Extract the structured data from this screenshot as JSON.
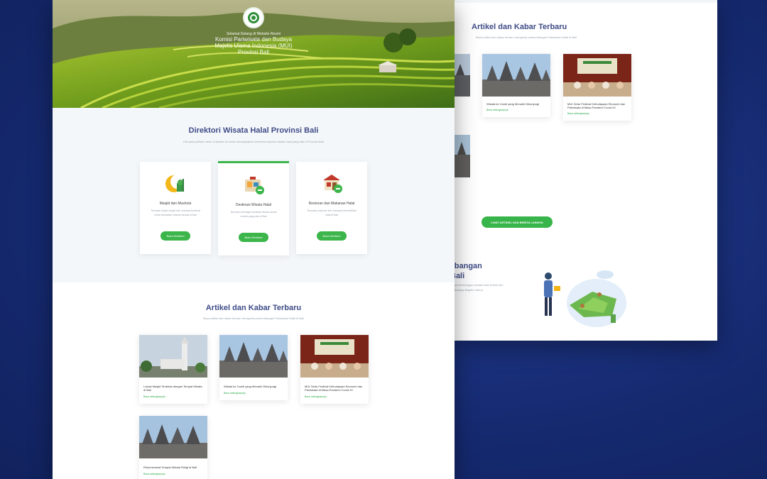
{
  "hero": {
    "line1": "Selamat Datang di Website Resmi",
    "line2": "Komisi Pariwisata dan Budaya",
    "line3": "Majelis Ulama Indonesia (MUI)",
    "line4": "Provinsi Bali"
  },
  "directory": {
    "title": "Direktori Wisata Halal Provinsi Bali",
    "subtitle": "Klik pada pilihan menu di bawah ini untuk mendapatkan informasi seputar wisata halal yang ada di Provinsi Bali",
    "cards": [
      {
        "title": "Masjid dan Mushola",
        "desc": "Temukan lokasi masjid dan mushola terdekat untuk beribadah selama berada di Bali",
        "button": "Buka Direktori"
      },
      {
        "title": "Destinasi Wisata Halal",
        "desc": "Temukan berbagai destinasi wisata ramah muslim yang ada di Bali",
        "button": "Buka Direktori"
      },
      {
        "title": "Restoran dan Makanan Halal",
        "desc": "Temukan restoran dan makanan bersertifikat halal di Bali",
        "button": "Buka Direktori"
      }
    ]
  },
  "articles": {
    "title": "Artikel dan Kabar Terbaru",
    "subtitle": "Baca artikel dan kabar terbaru mengenai perkembangan Pariwisata Halal di Bali",
    "items": [
      {
        "title": "Lokasi Masjid Terdekat dengan Tempat Wisata di Bali",
        "meta": "Baca selengkapnya"
      },
      {
        "title": "Wisata ke Candi yang Menarik Dikunjungi",
        "meta": "Baca selengkapnya"
      },
      {
        "title": "MUI Gelar Festival Kebudayaan Ekonomi dan Pariwisata di Masa Pandemi Covid-19",
        "meta": "Baca selengkapnya"
      },
      {
        "title": "Rekomendasi Tempat Wisata Religi di Bali",
        "meta": "Baca selengkapnya"
      }
    ]
  },
  "back": {
    "title": "Artikel dan Kabar Terbaru",
    "subtitle": "Baca artikel dan kabar terbaru mengenai perkembangan Pariwisata Halal di Bali",
    "items": [
      {
        "title": "Wisata ke Candi yang Menarik Dikunjungi",
        "meta": "Baca selengkapnya"
      },
      {
        "title": "MUI Gelar Festival Kebudayaan Ekonomi dan Pariwisata di Masa Pandemi Covid-19",
        "meta": "Baca selengkapnya"
      }
    ],
    "button": "LIHAT ARTIKEL DAN BERITA LAINNYA",
    "section_title_1": "mbangan",
    "section_title_2": "Bali",
    "section_text": "perkembangan wisata halal di Bali dan Budaya Majelis Ulama"
  },
  "colors": {
    "accent": "#3cb54a",
    "title": "#3f4c87",
    "bg": "#15296f"
  }
}
